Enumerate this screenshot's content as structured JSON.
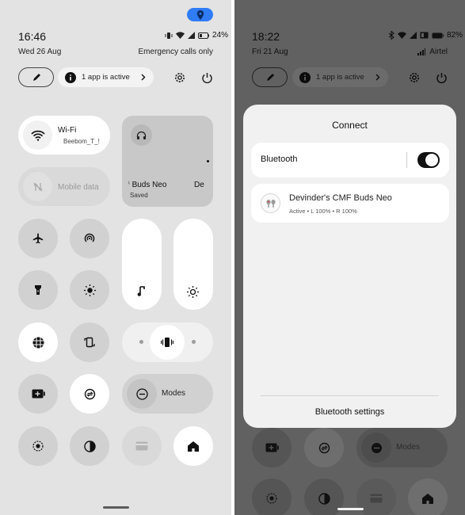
{
  "left_panel": {
    "location_badge_icon": "location-pin-icon",
    "time": "16:46",
    "date": "Wed 26 Aug",
    "battery_percent": "24%",
    "emergency_text": "Emergency calls only",
    "active_apps_label": "1 app is active",
    "wifi": {
      "label": "Wi-Fi",
      "network": "Beebom_T_!"
    },
    "mobile_data_label": "Mobile data",
    "buds_tile": {
      "left_text": "Buds Neo",
      "right_text": "De",
      "status": "Saved"
    },
    "modes_label": "Modes"
  },
  "right_panel": {
    "time": "18:22",
    "date": "Fri 21 Aug",
    "battery_percent": "82%",
    "carrier": "Airtel",
    "active_apps_label": "1 app is active",
    "modes_label": "Modes",
    "connect_dialog": {
      "title": "Connect",
      "bluetooth_label": "Bluetooth",
      "bluetooth_on": true,
      "device_name": "Devinder's CMF Buds Neo",
      "device_status": "Active • L 100% • R 100%",
      "settings_link": "Bluetooth settings"
    }
  },
  "colors": {
    "accent_blue": "#2f7cf6",
    "panel_bg_light": "#e3e3e3",
    "panel_bg_dim": "#616161",
    "dialog_bg": "#f1f1f1"
  }
}
